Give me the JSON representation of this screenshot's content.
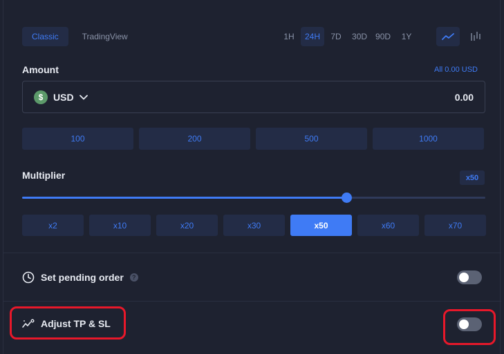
{
  "chart_tabs": [
    {
      "label": "Classic",
      "active": true
    },
    {
      "label": "TradingView",
      "active": false
    }
  ],
  "periods": [
    {
      "label": "1H",
      "active": false
    },
    {
      "label": "24H",
      "active": true
    },
    {
      "label": "7D",
      "active": false
    },
    {
      "label": "30D",
      "active": false
    },
    {
      "label": "90D",
      "active": false
    },
    {
      "label": "1Y",
      "active": false
    }
  ],
  "chart_types": [
    {
      "icon": "line-chart-icon",
      "active": true
    },
    {
      "icon": "candlestick-chart-icon",
      "active": false
    }
  ],
  "amount": {
    "label": "Amount",
    "all_link": "All 0.00 USD",
    "currency": "USD",
    "currency_symbol": "$",
    "value": "0.00",
    "presets": [
      "100",
      "200",
      "500",
      "1000"
    ]
  },
  "multiplier": {
    "label": "Multiplier",
    "badge": "x50",
    "slider_fraction": 0.7,
    "options": [
      {
        "label": "x2",
        "active": false
      },
      {
        "label": "x10",
        "active": false
      },
      {
        "label": "x20",
        "active": false
      },
      {
        "label": "x30",
        "active": false
      },
      {
        "label": "x50",
        "active": true
      },
      {
        "label": "x60",
        "active": false
      },
      {
        "label": "x70",
        "active": false
      }
    ]
  },
  "pending_order": {
    "label": "Set pending order",
    "help": "?",
    "enabled": false
  },
  "tp_sl": {
    "label": "Adjust TP & SL",
    "enabled": false
  },
  "colors": {
    "accent": "#3f7bf5",
    "highlight": "#e8182a",
    "background": "#1e2230"
  }
}
